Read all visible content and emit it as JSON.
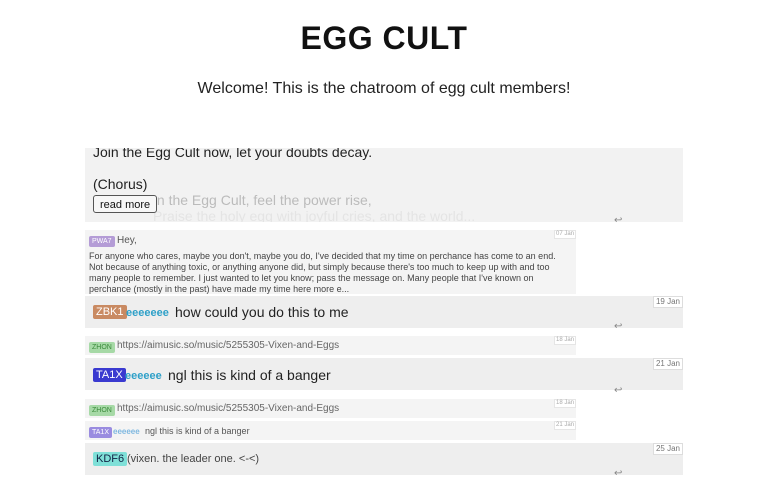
{
  "header": {
    "title": "EGG CULT",
    "subtitle": "Welcome! This is the chatroom of egg cult members!"
  },
  "pinned": {
    "line1": "Join the Egg Cult now, let your doubts decay.",
    "line2": "(Chorus)",
    "line3": "In the Egg Cult, feel the power rise,",
    "line4": "Praise the holy egg with joyful cries, and the world...",
    "read_more": "read more"
  },
  "messages": [
    {
      "badge": "PWA7",
      "badge_color": "#b49cd6",
      "greeting": "Hey,",
      "text": "For anyone who cares, maybe you don't, maybe you do, I've decided that my time on perchance has come to an end. Not because of anything toxic, or anything anyone did, but simply because there's too much to keep up with and too many people to remember. I just wanted to let you know; pass the message on. Many people that I've known on perchance (mostly in the past) have made my time here more e...",
      "date": "07 Jan"
    },
    {
      "badge": "ZBK1",
      "badge_color": "#c98a62",
      "user": "eeeeeee",
      "user_color": "#2ea0c8",
      "text": "how could you do this to me⁡",
      "date": "19 Jan"
    },
    {
      "badge": "ZHON",
      "badge_color": "#a6d9a6",
      "text": "https://aimusic.so/music/5255305-Vixen-and-Eggs",
      "date": "18 Jan"
    },
    {
      "badge": "TA1X",
      "badge_color": "#3a3ad0",
      "user": "eeeeee",
      "user_color": "#2ea0c8",
      "text": "ngl this is kind of a banger",
      "date": "21 Jan"
    },
    {
      "badge": "ZHON",
      "badge_color": "#a6d9a6",
      "text": "https://aimusic.so/music/5255305-Vixen-and-Eggs",
      "date": "18 Jan"
    },
    {
      "badge": "TA1X",
      "badge_color": "#9a8ce0",
      "user": "eeeeee",
      "user_color": "#7fb8e0",
      "text": "ngl this is kind of a banger",
      "date": "21 Jan"
    },
    {
      "badge": "KDF6",
      "badge_color": "#7fe0d8",
      "text": "(vixen. the leader one. <-<) ⁡",
      "date": "25 Jan"
    }
  ],
  "icons": {
    "reply": "↩",
    "menu": "⁡"
  }
}
